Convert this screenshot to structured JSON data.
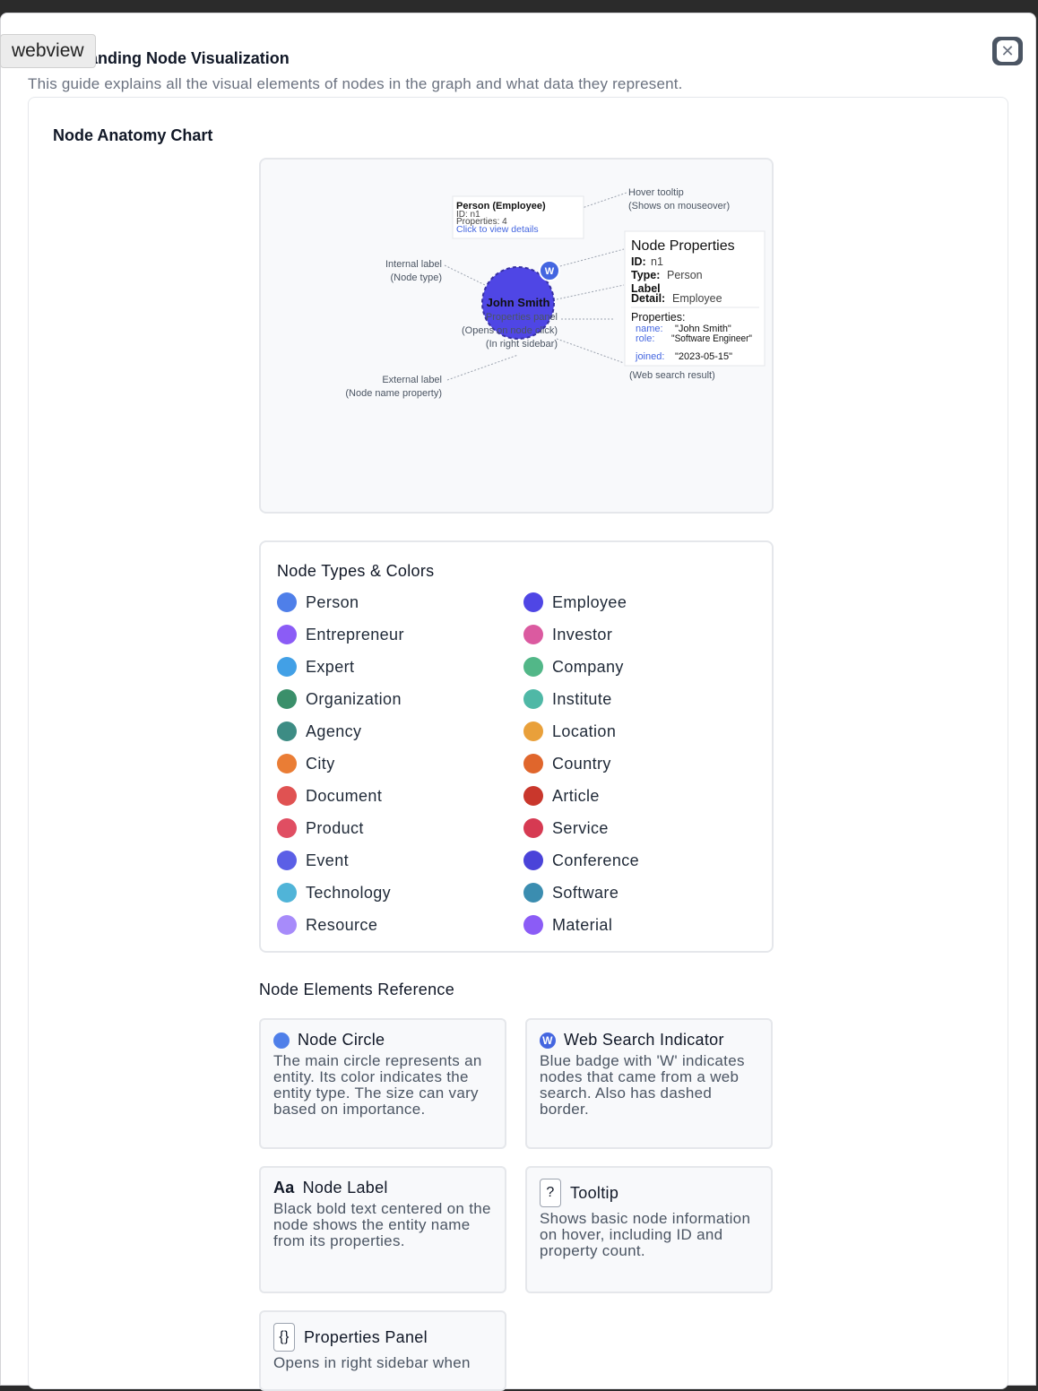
{
  "overlay_label": "webview",
  "dialog": {
    "title": "Understanding Node Visualization",
    "subtitle": "This guide explains all the visual elements of nodes in the graph and what data they represent.",
    "close_label": "✕"
  },
  "anatomy": {
    "heading": "Node Anatomy Chart",
    "node_label": "John Smith",
    "node_color": "#4f46e5",
    "web_badge": "W",
    "tooltip": {
      "title": "Person (Employee)",
      "id_line": "ID: n1",
      "props_line": "Properties: 4",
      "link": "Click to view details"
    },
    "annotations": {
      "hover_tooltip": "Hover tooltip",
      "hover_tooltip_sub": "(Shows on mouseover)",
      "internal_label": "Internal label",
      "internal_label_sub": "(Node type)",
      "properties_panel": "Properties panel",
      "properties_panel_sub1": "(Opens on node click)",
      "properties_panel_sub2": "(In right sidebar)",
      "external_label": "External label",
      "external_label_sub": "(Node name property)",
      "web_search": "(Web search result)"
    },
    "panel": {
      "title": "Node Properties",
      "id_key": "ID:",
      "id_val": "n1",
      "type_key": "Type:",
      "type_val": "Person",
      "label_key": "Label",
      "detail_key": "Detail:",
      "detail_val": "Employee",
      "props_heading": "Properties:",
      "props": [
        {
          "key": "name:",
          "value": "\"John Smith\""
        },
        {
          "key": "role:",
          "value": "\"Software Engineer\""
        },
        {
          "key": "joined:",
          "value": "\"2023-05-15\""
        }
      ]
    }
  },
  "legend": {
    "title": "Node Types & Colors",
    "items": [
      {
        "label": "Person",
        "color": "#4f7fe9"
      },
      {
        "label": "Employee",
        "color": "#4f46e5"
      },
      {
        "label": "Entrepreneur",
        "color": "#8b5cf6"
      },
      {
        "label": "Investor",
        "color": "#db5aa0"
      },
      {
        "label": "Expert",
        "color": "#42a0e6"
      },
      {
        "label": "Company",
        "color": "#52b788"
      },
      {
        "label": "Organization",
        "color": "#3a8f6a"
      },
      {
        "label": "Institute",
        "color": "#4fb8a6"
      },
      {
        "label": "Agency",
        "color": "#3d8c84"
      },
      {
        "label": "Location",
        "color": "#e9a03a"
      },
      {
        "label": "City",
        "color": "#ea7d35"
      },
      {
        "label": "Country",
        "color": "#e0662c"
      },
      {
        "label": "Document",
        "color": "#e05252"
      },
      {
        "label": "Article",
        "color": "#c9372c"
      },
      {
        "label": "Product",
        "color": "#e04e62"
      },
      {
        "label": "Service",
        "color": "#d63a52"
      },
      {
        "label": "Event",
        "color": "#5b5fe6"
      },
      {
        "label": "Conference",
        "color": "#4a43d9"
      },
      {
        "label": "Technology",
        "color": "#50b4d8"
      },
      {
        "label": "Software",
        "color": "#3b8db0"
      },
      {
        "label": "Resource",
        "color": "#a78bfa"
      },
      {
        "label": "Material",
        "color": "#8b5cf6"
      }
    ]
  },
  "reference": {
    "heading": "Node Elements Reference",
    "cards": [
      {
        "icon": "circle-icon",
        "title": "Node Circle",
        "desc": "The main circle represents an entity. Its color indicates the entity type. The size can vary based on importance."
      },
      {
        "icon": "web-badge-icon",
        "icon_text": "W",
        "title": "Web Search Indicator",
        "desc": "Blue badge with 'W' indicates nodes that came from a web search. Also has dashed border."
      },
      {
        "icon": "text-icon",
        "icon_text": "Aa",
        "title": "Node Label",
        "desc": "Black bold text centered on the node shows the entity name from its properties."
      },
      {
        "icon": "question-icon",
        "icon_text": "?",
        "title": "Tooltip",
        "desc": "Shows basic node information on hover, including ID and property count."
      },
      {
        "icon": "braces-icon",
        "icon_text": "{}",
        "title": "Properties Panel",
        "desc": "Opens in right sidebar when"
      }
    ]
  }
}
